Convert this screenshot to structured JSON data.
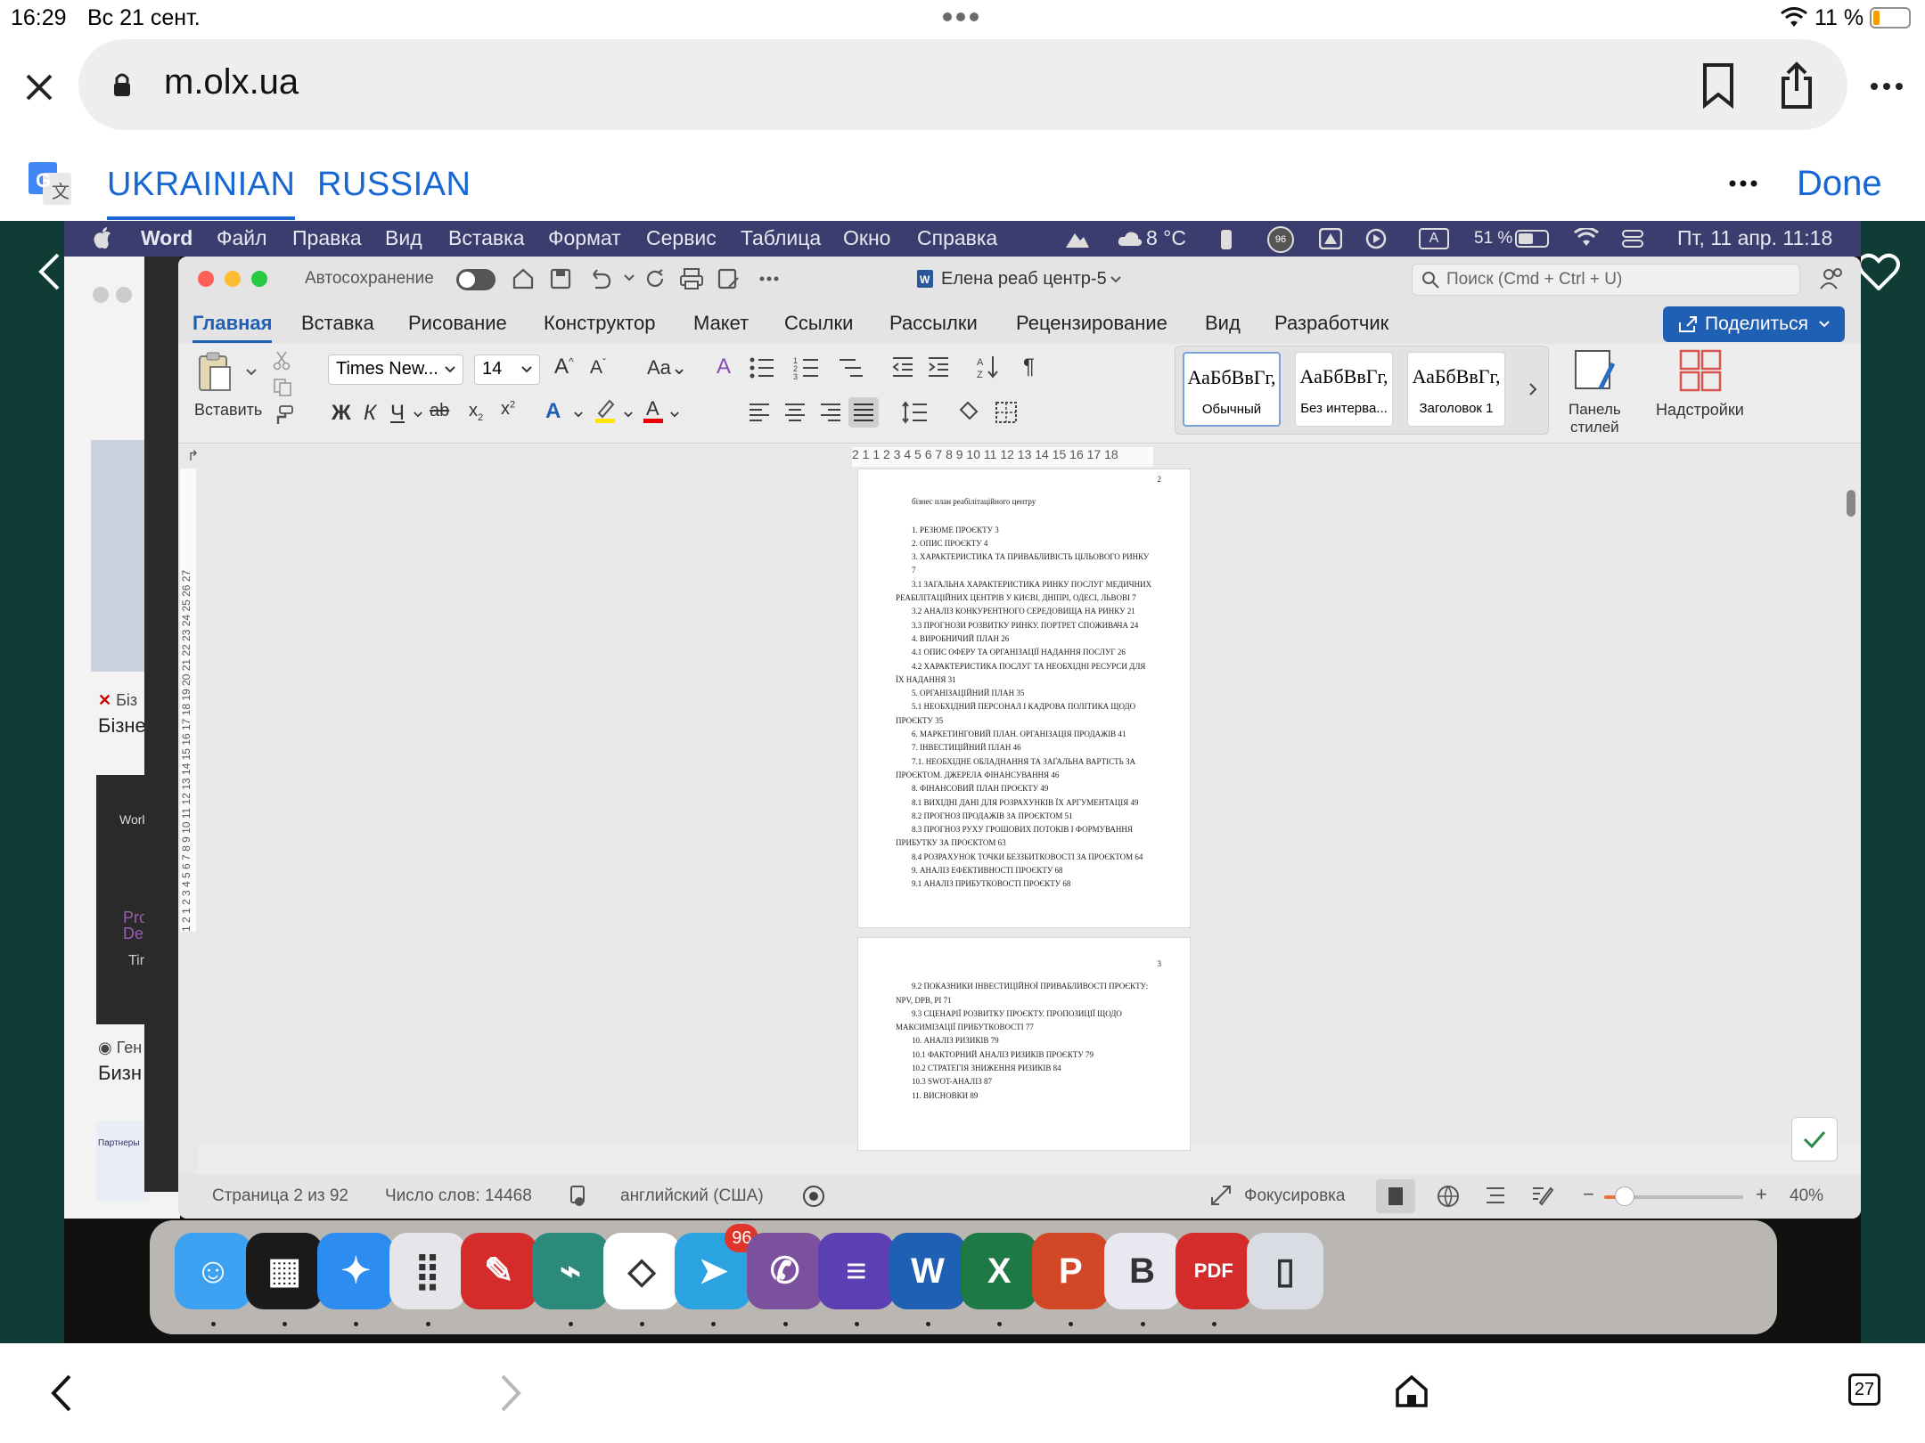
{
  "ios": {
    "time": "16:29",
    "date": "Вс 21 сент.",
    "battery": "11 %"
  },
  "safari": {
    "url": "m.olx.ua",
    "translate": {
      "lang_1": "UKRAINIAN",
      "lang_2": "RUSSIAN",
      "done": "Done"
    },
    "tab_count": "27"
  },
  "mac_menubar": {
    "app": "Word",
    "items": [
      "Файл",
      "Правка",
      "Вид",
      "Вставка",
      "Формат",
      "Сервис",
      "Таблица",
      "Окно",
      "Справка"
    ],
    "weather": "8 °C",
    "battery": "51 %",
    "badge": "96",
    "input_source": "A",
    "datetime": "Пт, 11 апр.  11:18"
  },
  "word": {
    "autosave_label": "Автосохранение",
    "doc_title": "Елена реаб центр-5",
    "search_placeholder": "Поиск (Cmd + Ctrl + U)",
    "tabs": [
      "Главная",
      "Вставка",
      "Рисование",
      "Конструктор",
      "Макет",
      "Ссылки",
      "Рассылки",
      "Рецензирование",
      "Вид",
      "Разработчик"
    ],
    "active_tab": "Главная",
    "share_label": "Поделиться",
    "paste_label": "Вставить",
    "font_name": "Times New...",
    "font_size": "14",
    "format_bold": "Ж",
    "format_italic": "К",
    "format_underline": "Ч",
    "styles": [
      {
        "preview": "АаБбВвГг,",
        "name": "Обычный"
      },
      {
        "preview": "АаБбВвГг,",
        "name": "Без интерва..."
      },
      {
        "preview": "АаБбВвГг,",
        "name": "Заголовок 1"
      }
    ],
    "styles_pane_label_1": "Панель",
    "styles_pane_label_2": "стилей",
    "addins_label": "Надстройки",
    "ruler_text": "2 1  1 2 3 4 5 6 7 8 9 10 11 12 13 14 15 16 17 18",
    "vruler_text": "1 2 1 2 3 4 5 6 7 8 9 10 11 12 13 14 15 16 17 18 19 20 21 22 23 24 25 26 27",
    "page2": {
      "number": "2",
      "heading": "бізнес план реабілітаційного центру",
      "lines": [
        "1. РЕЗЮМЕ ПРОЄКТУ   3",
        "2. ОПИС ПРОЄКТУ      4",
        "3. ХАРАКТЕРИСТИКА ТА ПРИВАБЛИВІСТЬ ЦІЛЬОВОГО РИНКУ",
        "7",
        "3.1 ЗАГАЛЬНА ХАРАКТЕРИСТИКА РИНКУ ПОСЛУГ МЕДИЧНИХ",
        "РЕАБІЛІТАЦІЙНИХ ЦЕНТРІВ У КИЄВІ, ДНІПРІ, ОДЕСІ, ЛЬВОВІ    7",
        "3.2 АНАЛІЗ КОНКУРЕНТНОГО СЕРЕДОВИЩА НА РИНКУ    21",
        "3.3 ПРОГНОЗИ РОЗВИТКУ РИНКУ. ПОРТРЕТ СПОЖИВАЧА    24",
        "4. ВИРОБНИЧИЙ ПЛАН        26",
        "4.1 ОПИС ОФЕРУ ТА ОРГАНІЗАЦІЇ НАДАННЯ ПОСЛУГ   26",
        "4.2 ХАРАКТЕРИСТИКА ПОСЛУГ ТА НЕОБХІДНІ РЕСУРСИ ДЛЯ",
        "ЇХ НАДАННЯ    31",
        "5. ОРГАНІЗАЦІЙНИЙ ПЛАН  35",
        "5.1 НЕОБХІДНИЙ ПЕРСОНАЛ І КАДРОВА ПОЛІТИКА ЩОДО",
        "ПРОЄКТУ 35",
        "6. МАРКЕТИНГОВИЙ ПЛАН. ОРГАНІЗАЦІЯ ПРОДАЖІВ  41",
        "7. ІНВЕСТИЦІЙНИЙ ПЛАН    46",
        "7.1. НЕОБХІДНЕ ОБЛАДНАННЯ ТА ЗАГАЛЬНА ВАРТІСТЬ ЗА",
        "ПРОЄКТОМ. ДЖЕРЕЛА ФІНАНСУВАННЯ     46",
        "8. ФІНАНСОВИЙ ПЛАН ПРОЄКТУ 49",
        "8.1 ВИХІДНІ ДАНІ ДЛЯ РОЗРАХУНКІВ ЇХ АРГУМЕНТАЦІЯ     49",
        "8.2 ПРОГНОЗ ПРОДАЖІВ ЗА ПРОЄКТОМ       51",
        "8.3 ПРОГНОЗ РУХУ ГРОШОВИХ ПОТОКІВ І ФОРМУВАННЯ",
        "ПРИБУТКУ ЗА ПРОЄКТОМ 63",
        "8.4 РОЗРАХУНОК ТОЧКИ БЕЗЗБИТКОВОСТІ ЗА ПРОЄКТОМ     64",
        "9. АНАЛІЗ ЕФЕКТИВНОСТІ ПРОЄКТУ    68",
        "9.1 АНАЛІЗ ПРИБУТКОВОСТІ ПРОЄКТУ          68"
      ]
    },
    "page3": {
      "number": "3",
      "lines": [
        "9.2 ПОКАЗНИКИ ІНВЕСТИЦІЙНОЇ ПРИВАБЛИВОСТІ ПРОЄКТУ:",
        "NPV, DPB, PI      71",
        "9.3 СЦЕНАРІЇ РОЗВИТКУ ПРОЄКТУ. ПРОПОЗИЦІЇ ЩОДО",
        "МАКСИМІЗАЦІЇ ПРИБУТКОВОСТІ       77",
        "10. АНАЛІЗ РИЗИКІВ     79",
        "10.1 ФАКТОРНИЙ АНАЛІЗ РИЗИКІВ ПРОЄКТУ        79",
        "10.2 СТРАТЕГІЯ ЗНИЖЕННЯ РИЗИКІВ    84",
        "10.3 SWOT-АНАЛІЗ       87",
        "11. ВИСНОВКИ     89"
      ]
    },
    "status": {
      "page": "Страница 2 из 92",
      "words": "Число слов: 14468",
      "language": "английский (США)",
      "focus": "Фокусировка",
      "zoom": "40%",
      "zoom_level": 0.4
    }
  },
  "background_app": {
    "item_1_label": "Біз",
    "item_1_title": "Бізне",
    "item_2_label": "Ген",
    "item_2_title": "Бизн",
    "thumb_text_1": "Work",
    "thumb_text_2": "Pro",
    "thumb_text_3": "De",
    "thumb_text_4": "Tir",
    "thumb_text_5": "Партнеры"
  },
  "dock": {
    "telegram_badge": "96",
    "apps": [
      "finder-icon",
      "mission-control-icon",
      "safari-icon",
      "launchpad-icon",
      "pin-icon",
      "broom-icon",
      "share-icon",
      "telegram-icon",
      "viber-icon",
      "lists-icon",
      "word-icon",
      "excel-icon",
      "powerpoint-icon",
      "bbedit-icon",
      "pdf-icon",
      "trash-icon"
    ]
  },
  "colors": {
    "accent": "#1666d4",
    "word_blue": "#1f5fb4",
    "mac_menubar": "#3b3d6e"
  }
}
